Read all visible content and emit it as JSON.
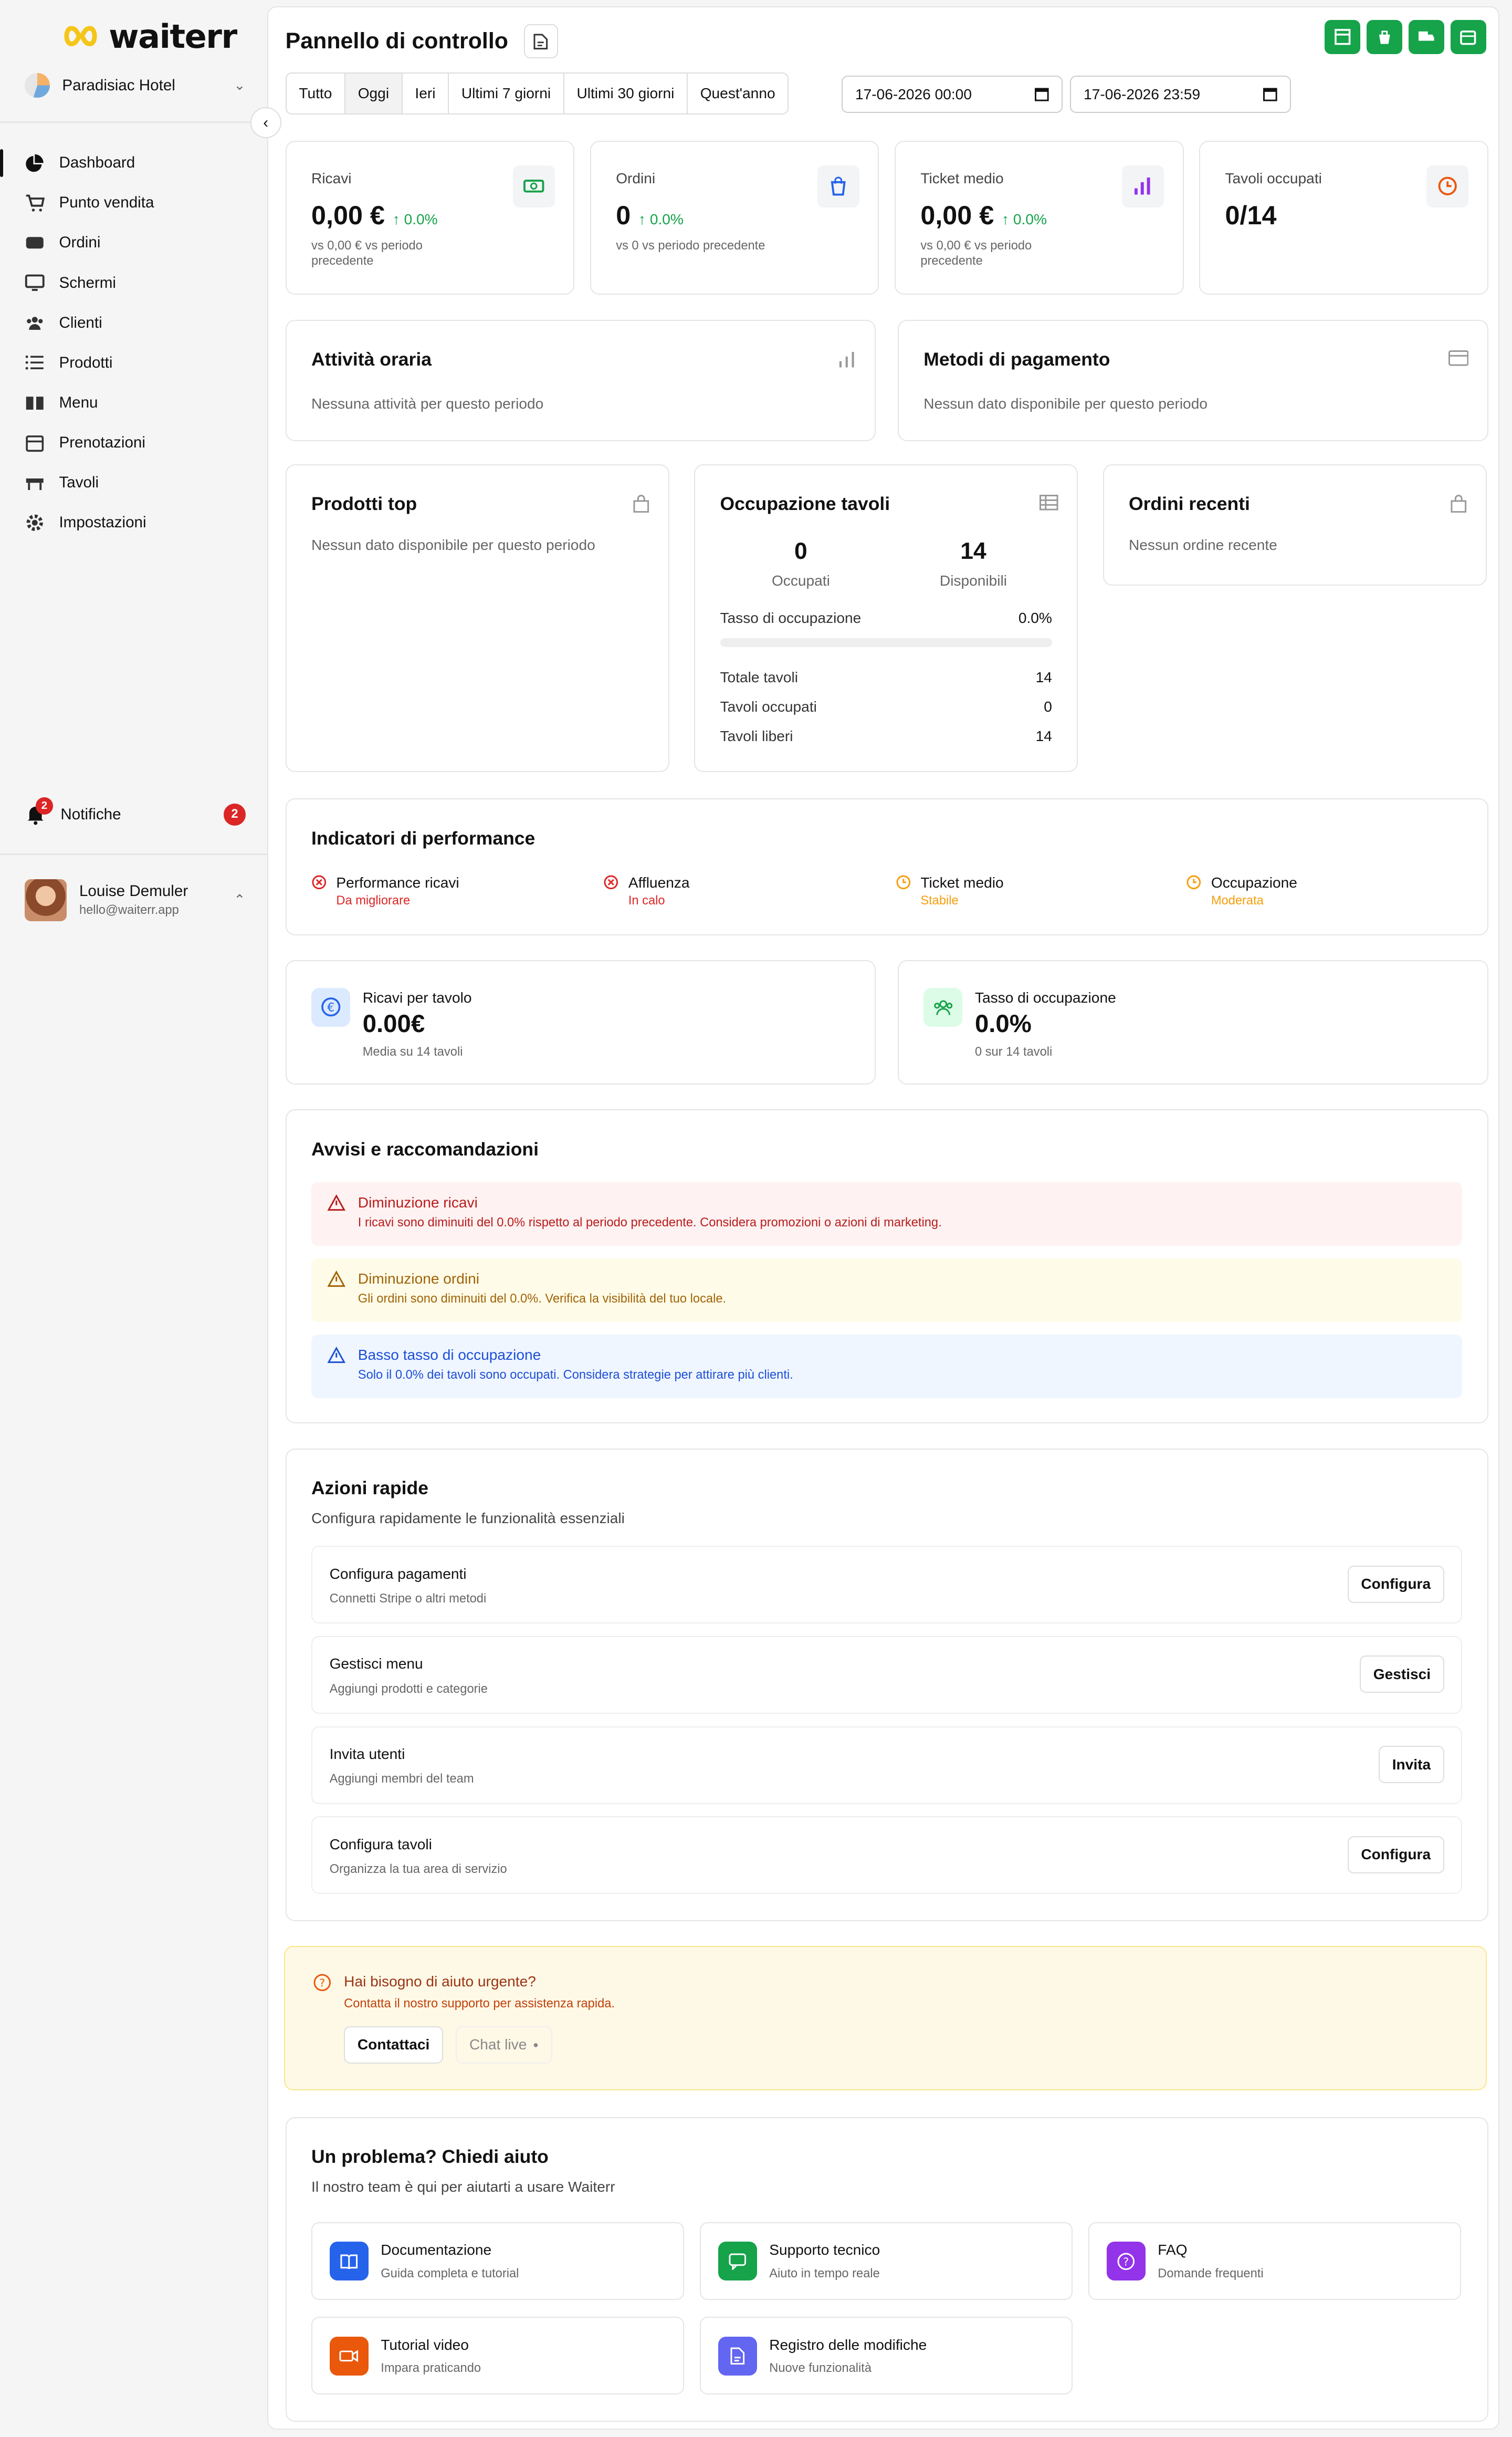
{
  "app": {
    "brand": "waiterr",
    "venue": "Paradisiac Hotel"
  },
  "sidebar": {
    "items": [
      {
        "label": "Dashboard",
        "icon": "pie-chart-icon"
      },
      {
        "label": "Punto vendita",
        "icon": "cart-icon"
      },
      {
        "label": "Ordini",
        "icon": "orders-icon"
      },
      {
        "label": "Schermi",
        "icon": "monitor-icon"
      },
      {
        "label": "Clienti",
        "icon": "users-icon"
      },
      {
        "label": "Prodotti",
        "icon": "list-icon"
      },
      {
        "label": "Menu",
        "icon": "book-icon"
      },
      {
        "label": "Prenotazioni",
        "icon": "calendar-icon"
      },
      {
        "label": "Tavoli",
        "icon": "table-icon"
      },
      {
        "label": "Impostazioni",
        "icon": "gear-icon"
      }
    ],
    "notifications": {
      "label": "Notifiche",
      "count": "2"
    },
    "user": {
      "name": "Louise Demuler",
      "email": "hello@waiterr.app"
    }
  },
  "header": {
    "title": "Pannello di controllo"
  },
  "periods": [
    "Tutto",
    "Oggi",
    "Ieri",
    "Ultimi 7 giorni",
    "Ultimi 30 giorni",
    "Quest'anno"
  ],
  "selected_period": "Oggi",
  "date_from": "17-06-2026 00:00",
  "date_to": "17-06-2026 23:59",
  "kpis": [
    {
      "label": "Ricavi",
      "value": "0,00 €",
      "change": "0.0%",
      "sub": "vs 0,00 € vs periodo precedente",
      "icon": "money-icon",
      "color": "#16a34a"
    },
    {
      "label": "Ordini",
      "value": "0",
      "change": "0.0%",
      "sub": "vs 0 vs periodo precedente",
      "icon": "bag-icon",
      "color": "#2563eb"
    },
    {
      "label": "Ticket medio",
      "value": "0,00 €",
      "change": "0.0%",
      "sub": "vs 0,00 € vs periodo precedente",
      "icon": "bar-chart-icon",
      "color": "#9333ea"
    },
    {
      "label": "Tavoli occupati",
      "value": "0/14",
      "change": "",
      "sub": "",
      "icon": "clock-icon",
      "color": "#ea580c"
    }
  ],
  "hourly": {
    "title": "Attività oraria",
    "empty": "Nessuna attività per questo periodo"
  },
  "payments": {
    "title": "Metodi di pagamento",
    "empty": "Nessun dato disponibile per questo periodo"
  },
  "top_products": {
    "title": "Prodotti top",
    "empty": "Nessun dato disponibile per questo periodo"
  },
  "occupancy": {
    "title": "Occupazione tavoli",
    "occupied": "0",
    "occupied_label": "Occupati",
    "available": "14",
    "available_label": "Disponibili",
    "rate_label": "Tasso di occupazione",
    "rate": "0.0%",
    "rate_fraction": 0,
    "rows": [
      {
        "label": "Totale tavoli",
        "value": "14"
      },
      {
        "label": "Tavoli occupati",
        "value": "0"
      },
      {
        "label": "Tavoli liberi",
        "value": "14"
      }
    ]
  },
  "recent_orders": {
    "title": "Ordini recenti",
    "empty": "Nessun ordine recente"
  },
  "performance": {
    "title": "Indicatori di performance",
    "items": [
      {
        "name": "Performance ricavi",
        "status": "Da migliorare",
        "color": "#dc2626"
      },
      {
        "name": "Affluenza",
        "status": "In calo",
        "color": "#dc2626"
      },
      {
        "name": "Ticket medio",
        "status": "Stabile",
        "color": "#f59e0b"
      },
      {
        "name": "Occupazione",
        "status": "Moderata",
        "color": "#f59e0b"
      }
    ]
  },
  "metrics": [
    {
      "label": "Ricavi per tavolo",
      "value": "0.00€",
      "sub": "Media su 14 tavoli",
      "icon": "euro-icon"
    },
    {
      "label": "Tasso di occupazione",
      "value": "0.0%",
      "sub": "0 sur 14 tavoli",
      "icon": "people-icon"
    }
  ],
  "alerts": {
    "title": "Avvisi e raccomandazioni",
    "items": [
      {
        "title": "Diminuzione ricavi",
        "desc": "I ricavi sono diminuiti del 0.0% rispetto al periodo precedente. Considera promozioni o azioni di marketing.",
        "bg": "#fef2f2",
        "fg": "#b91c1c"
      },
      {
        "title": "Diminuzione ordini",
        "desc": "Gli ordini sono diminuiti del 0.0%. Verifica la visibilità del tuo locale.",
        "bg": "#fefce8",
        "fg": "#a16207"
      },
      {
        "title": "Basso tasso di occupazione",
        "desc": "Solo il 0.0% dei tavoli sono occupati. Considera strategie per attirare più clienti.",
        "bg": "#eff6ff",
        "fg": "#1d4ed8"
      }
    ]
  },
  "quick_actions": {
    "title": "Azioni rapide",
    "subtitle": "Configura rapidamente le funzionalità essenziali",
    "items": [
      {
        "title": "Configura pagamenti",
        "desc": "Connetti Stripe o altri metodi",
        "button": "Configura"
      },
      {
        "title": "Gestisci menu",
        "desc": "Aggiungi prodotti e categorie",
        "button": "Gestisci"
      },
      {
        "title": "Invita utenti",
        "desc": "Aggiungi membri del team",
        "button": "Invita"
      },
      {
        "title": "Configura tavoli",
        "desc": "Organizza la tua area di servizio",
        "button": "Configura"
      }
    ]
  },
  "urgent": {
    "title": "Hai bisogno di aiuto urgente?",
    "desc": "Contatta il nostro supporto per assistenza rapida.",
    "contact": "Contattaci",
    "chat": "Chat live"
  },
  "help": {
    "title": "Un problema? Chiedi aiuto",
    "subtitle": "Il nostro team è qui per aiutarti a usare Waiterr",
    "items": [
      {
        "title": "Documentazione",
        "desc": "Guida completa e tutorial",
        "icon": "book-icon",
        "color": "#2563eb"
      },
      {
        "title": "Supporto tecnico",
        "desc": "Aiuto in tempo reale",
        "icon": "chat-icon",
        "color": "#16a34a"
      },
      {
        "title": "FAQ",
        "desc": "Domande frequenti",
        "icon": "question-icon",
        "color": "#9333ea"
      },
      {
        "title": "Tutorial video",
        "desc": "Impara praticando",
        "icon": "video-icon",
        "color": "#ea580c"
      },
      {
        "title": "Registro delle modifiche",
        "desc": "Nuove funzionalità",
        "icon": "changelog-icon",
        "color": "#6366f1"
      }
    ]
  }
}
